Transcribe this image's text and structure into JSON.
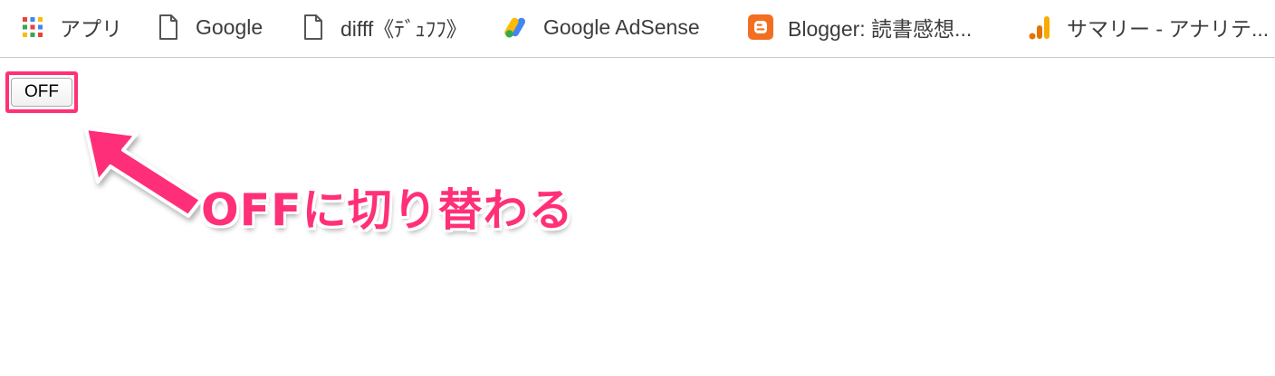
{
  "bookmarks": [
    {
      "label": "アプリ",
      "icon": "apps-grid-icon"
    },
    {
      "label": "Google",
      "icon": "page-icon"
    },
    {
      "label": "difff《ﾃﾞｭﾌﾌ》",
      "icon": "page-icon"
    },
    {
      "label": "Google AdSense",
      "icon": "adsense-icon"
    },
    {
      "label": "Blogger: 読書感想...",
      "icon": "blogger-icon"
    },
    {
      "label": "サマリー - アナリテ...",
      "icon": "analytics-icon"
    }
  ],
  "main": {
    "toggle_button_label": "OFF",
    "annotation_text": "OFFに切り替わる"
  },
  "colors": {
    "annotation": "#ff2f78",
    "blogger": "#f26f21",
    "analytics": "#f9ab00"
  }
}
